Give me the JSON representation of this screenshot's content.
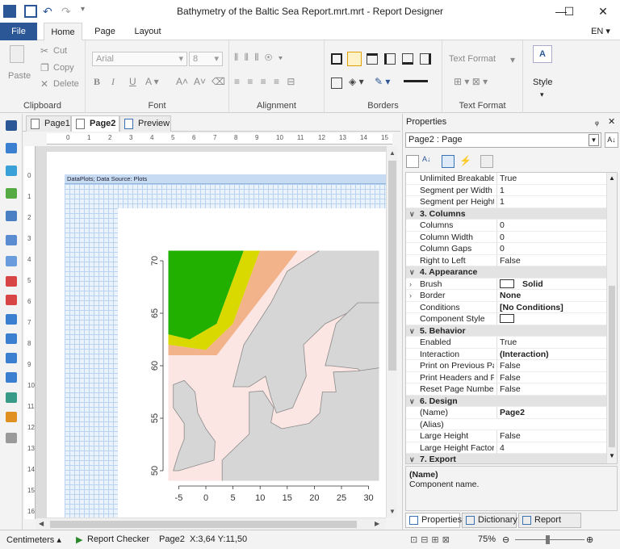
{
  "window": {
    "title": "Bathymetry of the Baltic Sea Report.mrt.mrt  -  Report Designer",
    "minimize": "—",
    "maximize": "☐",
    "close": "✕"
  },
  "ribbon_tabs": [
    "File",
    "Home",
    "Page",
    "Layout"
  ],
  "language": "EN",
  "ribbon": {
    "clipboard": {
      "paste": "Paste",
      "cut": "Cut",
      "copy": "Copy",
      "delete": "Delete",
      "label": "Clipboard"
    },
    "font": {
      "family": "Arial",
      "size": "8",
      "label": "Font"
    },
    "alignment": {
      "label": "Alignment"
    },
    "borders": {
      "label": "Borders"
    },
    "text_format": {
      "value": "Text Format",
      "label": "Text Format"
    },
    "style": {
      "label": "Style"
    }
  },
  "doc_tabs": [
    "Page1",
    "Page2",
    "Preview"
  ],
  "ruler_h": [
    "0",
    "1",
    "2",
    "3",
    "4",
    "5",
    "6",
    "7",
    "8",
    "9",
    "10",
    "11",
    "12",
    "13",
    "14",
    "15"
  ],
  "ruler_v": [
    "0",
    "1",
    "2",
    "3",
    "4",
    "5",
    "6",
    "7",
    "8",
    "9",
    "10",
    "11",
    "12",
    "13",
    "14",
    "15",
    "16"
  ],
  "band_header": "DataPlots; Data Source: Plots",
  "chart_data": {
    "type": "heatmap",
    "x_ticks": [
      "-5",
      "0",
      "5",
      "10",
      "15",
      "20",
      "25",
      "30"
    ],
    "y_ticks": [
      "50",
      "55",
      "60",
      "65",
      "70"
    ],
    "xlim": [
      -7,
      32
    ],
    "ylim": [
      49,
      71
    ],
    "colors": {
      "deep": "#22b000",
      "mid": "#d9d900",
      "shallow": "#f2b38a",
      "land": "#d6d6d6",
      "sea": "#fbe6e3"
    }
  },
  "properties": {
    "header": "Properties",
    "pin": "ᵩ",
    "close": "✕",
    "component": "Page2 : Page",
    "rows": [
      {
        "k": "Unlimited Breakable",
        "v": "True",
        "cat": false
      },
      {
        "k": "Segment per Width",
        "v": "1",
        "cat": false
      },
      {
        "k": "Segment per Height",
        "v": "1",
        "cat": false
      },
      {
        "k": "3. Columns",
        "v": "",
        "cat": true
      },
      {
        "k": "Columns",
        "v": "0",
        "cat": false
      },
      {
        "k": "Column Width",
        "v": "0",
        "cat": false
      },
      {
        "k": "Column Gaps",
        "v": "0",
        "cat": false
      },
      {
        "k": "Right to Left",
        "v": "False",
        "cat": false
      },
      {
        "k": "4. Appearance",
        "v": "",
        "cat": true
      },
      {
        "k": "Brush",
        "v": "Solid",
        "cat": false,
        "bold": true,
        "swatch": true,
        "expander": true
      },
      {
        "k": "Border",
        "v": "None",
        "cat": false,
        "bold": true,
        "expander": true
      },
      {
        "k": "Conditions",
        "v": "[No Conditions]",
        "cat": false,
        "bold": true
      },
      {
        "k": "Component Style",
        "v": "",
        "cat": false,
        "swatch": true
      },
      {
        "k": "5. Behavior",
        "v": "",
        "cat": true
      },
      {
        "k": "Enabled",
        "v": "True",
        "cat": false
      },
      {
        "k": "Interaction",
        "v": "(Interaction)",
        "cat": false,
        "bold": true
      },
      {
        "k": "Print on Previous Page",
        "v": "False",
        "cat": false
      },
      {
        "k": "Print Headers and Footers",
        "v": "False",
        "cat": false
      },
      {
        "k": "Reset Page Number",
        "v": "False",
        "cat": false
      },
      {
        "k": "6. Design",
        "v": "",
        "cat": true
      },
      {
        "k": "(Name)",
        "v": "Page2",
        "cat": false,
        "bold": true
      },
      {
        "k": "(Alias)",
        "v": "",
        "cat": false
      },
      {
        "k": "Large Height",
        "v": "False",
        "cat": false
      },
      {
        "k": "Large Height Factor",
        "v": "4",
        "cat": false
      },
      {
        "k": "7. Export",
        "v": "",
        "cat": true
      }
    ],
    "desc_title": "(Name)",
    "desc_text": "Component name.",
    "bottom_tabs": [
      "Properties",
      "Dictionary",
      "Report Tree"
    ]
  },
  "status": {
    "units": "Centimeters",
    "checker": "Report Checker",
    "page": "Page2",
    "coords": "X:3,64 Y:11,50",
    "zoom": "75%"
  }
}
